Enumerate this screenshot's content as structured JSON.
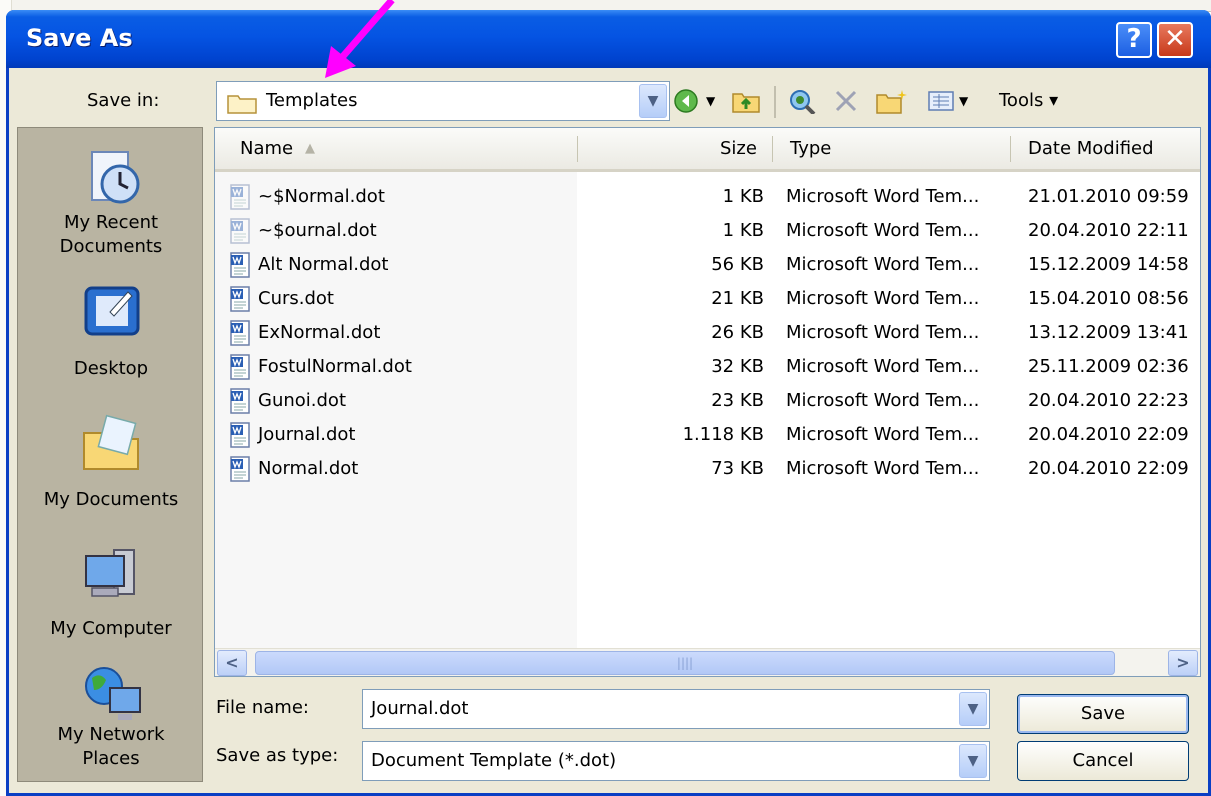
{
  "window": {
    "title": "Save As",
    "help_glyph": "?",
    "close_glyph": "✕"
  },
  "toolbar": {
    "save_in_label": "Save in:",
    "save_in_value": "Templates",
    "tools_label": "Tools ▾",
    "icons": [
      "back-icon",
      "up-folder-icon",
      "search-web-icon",
      "delete-icon",
      "new-folder-icon",
      "views-icon",
      "tools-icon"
    ]
  },
  "places": [
    {
      "label_1": "My Recent",
      "label_2": "Documents",
      "icon": "recent-documents-icon"
    },
    {
      "label_1": "Desktop",
      "icon": "desktop-icon"
    },
    {
      "label_1": "My Documents",
      "icon": "my-documents-icon"
    },
    {
      "label_1": "My Computer",
      "icon": "my-computer-icon"
    },
    {
      "label_1": "My Network",
      "label_2": "Places",
      "icon": "network-places-icon"
    }
  ],
  "columns": {
    "name": "Name",
    "size": "Size",
    "type": "Type",
    "date": "Date Modified",
    "sort_glyph": "▲"
  },
  "files": [
    {
      "name": "~$Normal.dot",
      "size": "1 KB",
      "type": "Microsoft Word Tem...",
      "date": "21.01.2010 09:59",
      "hidden": true
    },
    {
      "name": "~$ournal.dot",
      "size": "1 KB",
      "type": "Microsoft Word Tem...",
      "date": "20.04.2010 22:11",
      "hidden": true
    },
    {
      "name": "Alt Normal.dot",
      "size": "56 KB",
      "type": "Microsoft Word Tem...",
      "date": "15.12.2009 14:58"
    },
    {
      "name": "Curs.dot",
      "size": "21 KB",
      "type": "Microsoft Word Tem...",
      "date": "15.04.2010 08:56"
    },
    {
      "name": "ExNormal.dot",
      "size": "26 KB",
      "type": "Microsoft Word Tem...",
      "date": "13.12.2009 13:41"
    },
    {
      "name": "FostulNormal.dot",
      "size": "32 KB",
      "type": "Microsoft Word Tem...",
      "date": "25.11.2009 02:36"
    },
    {
      "name": "Gunoi.dot",
      "size": "23 KB",
      "type": "Microsoft Word Tem...",
      "date": "20.04.2010 22:23"
    },
    {
      "name": "Journal.dot",
      "size": "1.118 KB",
      "type": "Microsoft Word Tem...",
      "date": "20.04.2010 22:09"
    },
    {
      "name": "Normal.dot",
      "size": "73 KB",
      "type": "Microsoft Word Tem...",
      "date": "20.04.2010 22:09"
    }
  ],
  "scrollbar": {
    "left_glyph": "<",
    "right_glyph": ">",
    "grip": "||||"
  },
  "form": {
    "file_name_label": "File name:",
    "file_name_value": "Journal.dot",
    "save_type_label": "Save as type:",
    "save_type_value": "Document Template (*.dot)",
    "save_button": "Save",
    "cancel_button": "Cancel"
  },
  "colors": {
    "title_blue": "#0554e3",
    "annotation_arrow": "#ff00ff"
  }
}
